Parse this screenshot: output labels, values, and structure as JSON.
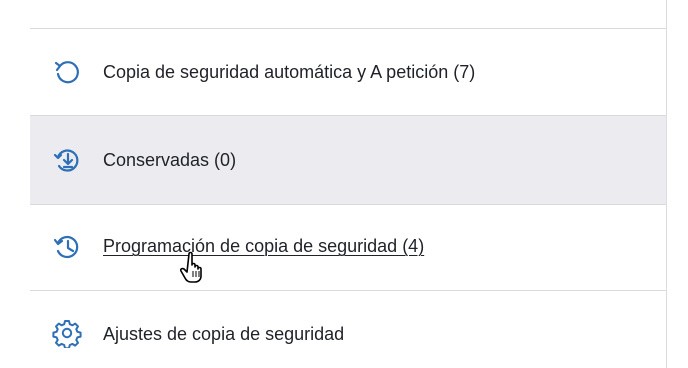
{
  "menu": {
    "items": [
      {
        "label": "Copia de seguridad automática y A petición (7)",
        "icon": "refresh-icon"
      },
      {
        "label": "Conservadas (0)",
        "icon": "download-circle-icon"
      },
      {
        "label": "Programación de copia de seguridad (4)",
        "icon": "history-clock-icon"
      },
      {
        "label": "Ajustes de copia de seguridad",
        "icon": "gear-icon"
      }
    ],
    "selected_index": 1,
    "hovered_index": 2
  },
  "colors": {
    "accent": "#2f6fb5",
    "selected_bg": "#ebebf0",
    "text": "#1f2229",
    "divider": "#d9dadf"
  }
}
